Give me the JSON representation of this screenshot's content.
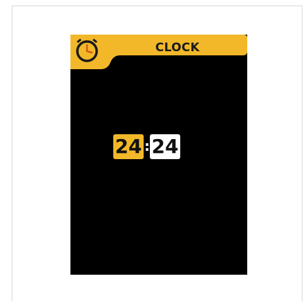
{
  "header": {
    "title": "CLOCK",
    "icon": "clock-icon",
    "accent_color": "#f2b829"
  },
  "time": {
    "hours": "24",
    "separator": ":",
    "minutes": "24",
    "hours_bg": "#f2b829",
    "minutes_bg": "#ffffff"
  }
}
